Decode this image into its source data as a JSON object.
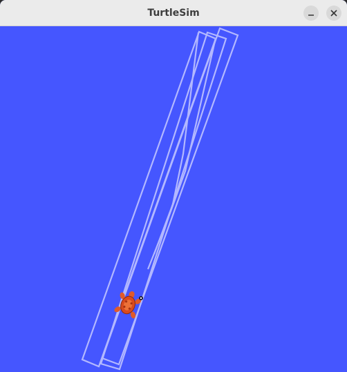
{
  "window": {
    "title": "TurtleSim",
    "minimize_icon": "minimize-icon",
    "close_icon": "close-icon"
  },
  "canvas": {
    "background_color": "#4556ff",
    "pen_color": "#b3b8ff",
    "turtle_color": "#d94a1e"
  }
}
